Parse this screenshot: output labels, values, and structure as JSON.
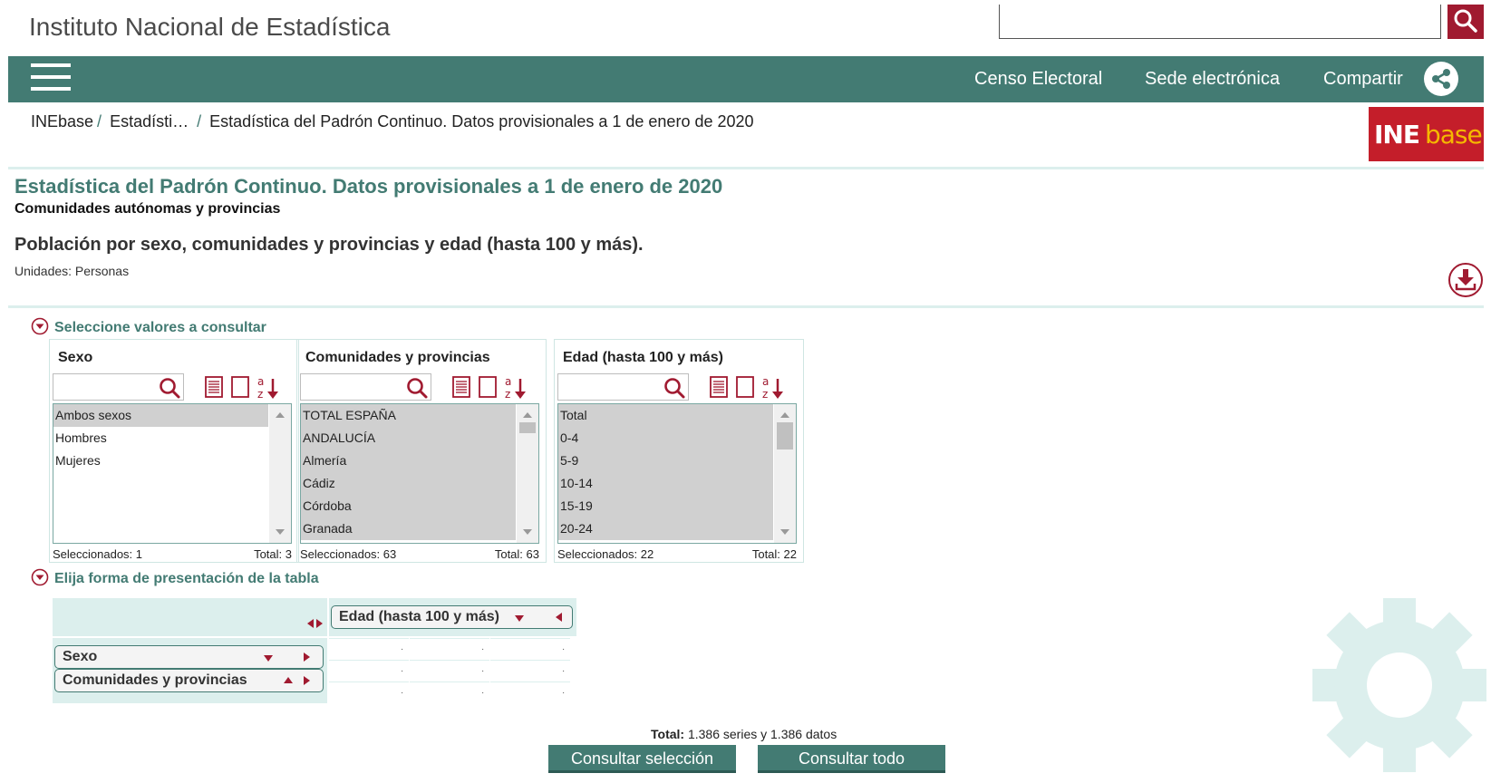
{
  "header": {
    "site_title": "Instituto Nacional de Estadística",
    "search_placeholder": ""
  },
  "nav": {
    "links": [
      "Censo Electoral",
      "Sede electrónica",
      "Compartir"
    ]
  },
  "breadcrumb": [
    "INEbase",
    "Estadísti…",
    "Estadística del Padrón Continuo. Datos provisionales a 1 de enero de 2020"
  ],
  "logo": {
    "part1": "INE",
    "part2": "base"
  },
  "page": {
    "title": "Estadística del Padrón Continuo. Datos provisionales a 1 de enero de 2020",
    "subtitle": "Comunidades autónomas y provincias",
    "table_title": "Población por sexo, comunidades y provincias y edad (hasta 100 y más).",
    "units": "Unidades: Personas"
  },
  "select_section": {
    "heading": "Seleccione valores a consultar",
    "variables": [
      {
        "title": "Sexo",
        "items": [
          "Ambos sexos",
          "Hombres",
          "Mujeres"
        ],
        "selected_label": "Seleccionados: 1",
        "total_label": "Total: 3"
      },
      {
        "title": "Comunidades y provincias",
        "items": [
          "TOTAL ESPAÑA",
          "ANDALUCÍA",
          "Almería",
          "Cádiz",
          "Córdoba",
          "Granada"
        ],
        "selected_label": "Seleccionados: 63",
        "total_label": "Total: 63"
      },
      {
        "title": "Edad (hasta 100 y más)",
        "items": [
          "Total",
          "0-4",
          "5-9",
          "10-14",
          "15-19",
          "20-24"
        ],
        "selected_label": "Seleccionados: 22",
        "total_label": "Total: 22"
      }
    ]
  },
  "layout_section": {
    "heading": "Elija forma de presentación de la tabla",
    "column_var": "Edad (hasta 100 y más)",
    "row_vars": [
      "Sexo",
      "Comunidades y provincias"
    ],
    "cell_placeholder": "."
  },
  "footer": {
    "total_label": "Total:",
    "total_text": "1.386 series y  1.386 datos",
    "btn_selection": "Consultar selección",
    "btn_all": "Consultar todo"
  },
  "colors": {
    "brand_green": "#437b73",
    "brand_red": "#a01a30",
    "light_green": "#dcefed"
  }
}
